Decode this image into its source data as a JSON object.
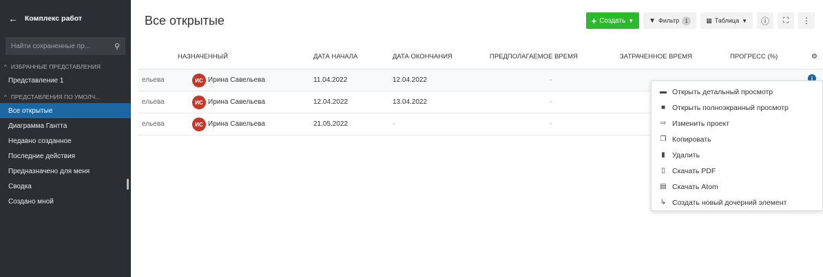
{
  "sidebar": {
    "title": "Комплекс работ",
    "search_placeholder": "Найти сохраненные пр...",
    "sections": [
      {
        "label": "ИЗБРАННЫЕ ПРЕДСТАВЛЕНИЯ",
        "items": [
          {
            "label": "Представление 1"
          }
        ]
      },
      {
        "label": "ПРЕДСТАВЛЕНИЯ ПО УМОЛЧ...",
        "items": [
          {
            "label": "Все открытые",
            "active": true
          },
          {
            "label": "Диаграмма Гантта"
          },
          {
            "label": "Недавно созданное"
          },
          {
            "label": "Последние действия"
          },
          {
            "label": "Предназначено для меня"
          },
          {
            "label": "Сводка"
          },
          {
            "label": "Создано мной"
          }
        ]
      }
    ]
  },
  "header": {
    "title": "Все открытые",
    "create_label": "Создать",
    "filter_label": "Фильтр",
    "filter_count": "1",
    "view_label": "Таблица"
  },
  "table": {
    "columns": [
      "НАЗНАЧЕННЫЙ",
      "ДАТА НАЧАЛА",
      "ДАТА ОКОНЧАНИЯ",
      "ПРЕДПОЛАГАЕМОЕ ВРЕМЯ",
      "ЗАТРАЧЕННОЕ ВРЕМЯ",
      "ПРОГРЕСС (%)"
    ],
    "rows": [
      {
        "author_fragment": "ельева",
        "avatar": "ИС",
        "assignee": "Ирина Савельева",
        "start": "11.04.2022",
        "end": "12.04.2022",
        "estimated": "-"
      },
      {
        "author_fragment": "ельева",
        "avatar": "ИС",
        "assignee": "Ирина Савельева",
        "start": "12.04.2022",
        "end": "13.04.2022",
        "estimated": "-"
      },
      {
        "author_fragment": "ельева",
        "avatar": "ИС",
        "assignee": "Ирина Савельева",
        "start": "21.05.2022",
        "end": "-",
        "estimated": "-"
      }
    ]
  },
  "context_menu": {
    "items": [
      {
        "label": "Открыть детальный просмотр",
        "icon": "details-view-icon"
      },
      {
        "label": "Открыть полноэкранный просмотр",
        "icon": "fullscreen-view-icon"
      },
      {
        "label": "Изменить проект",
        "icon": "move-project-icon"
      },
      {
        "label": "Копировать",
        "icon": "copy-icon"
      },
      {
        "label": "Удалить",
        "icon": "delete-icon"
      },
      {
        "label": "Скачать PDF",
        "icon": "pdf-file-icon"
      },
      {
        "label": "Скачать Atom",
        "icon": "atom-file-icon"
      },
      {
        "label": "Создать новый дочерний элемент",
        "icon": "child-element-icon"
      }
    ]
  },
  "colors": {
    "sidebar_bg": "#2b2f33",
    "active_item": "#1a67a3",
    "create_button": "#2eb82e",
    "avatar": "#c0392b"
  }
}
